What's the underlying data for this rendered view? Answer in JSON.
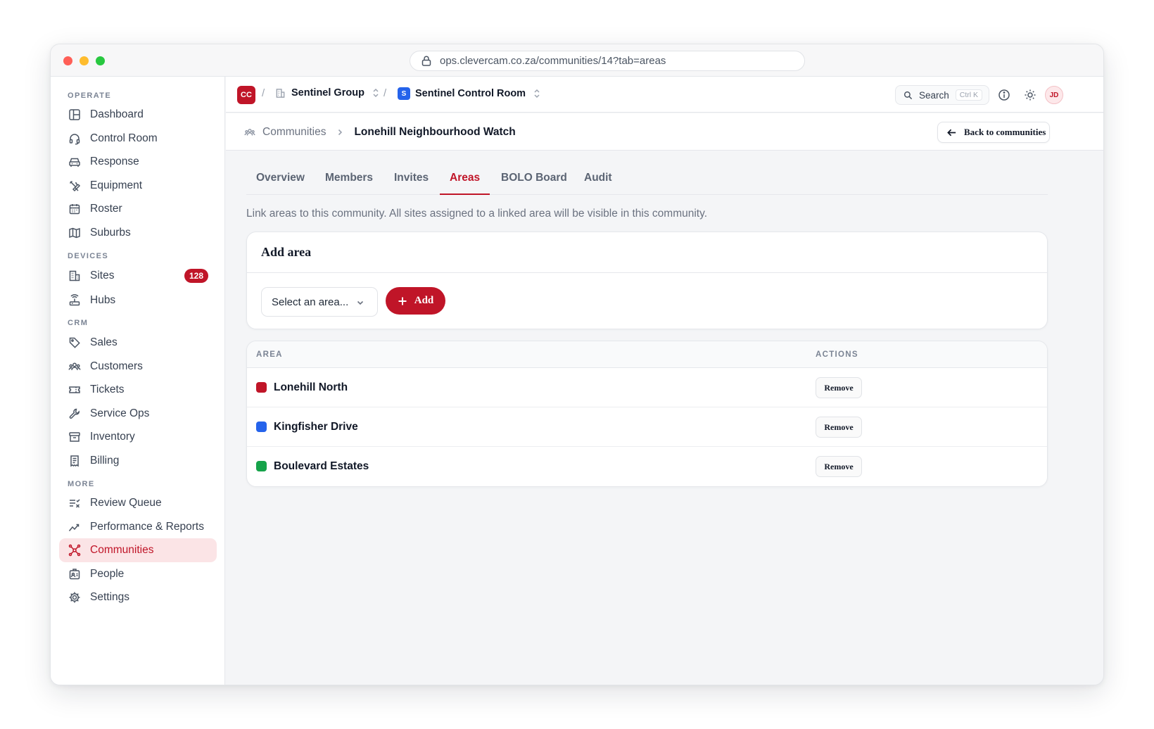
{
  "browser": {
    "url": "ops.clevercam.co.za/communities/14?tab=areas"
  },
  "sidebar": {
    "sections": [
      {
        "label": "OPERATE"
      },
      {
        "label": "DEVICES"
      },
      {
        "label": "CRM"
      },
      {
        "label": "MORE"
      }
    ],
    "items": [
      {
        "label": "Dashboard",
        "icon": "layout-icon"
      },
      {
        "label": "Control Room",
        "icon": "headset-icon"
      },
      {
        "label": "Response",
        "icon": "car-icon"
      },
      {
        "label": "Equipment",
        "icon": "tools-icon"
      },
      {
        "label": "Roster",
        "icon": "calendar-icon"
      },
      {
        "label": "Suburbs",
        "icon": "map-icon"
      },
      {
        "label": "Sites",
        "icon": "building-icon",
        "badge": "128"
      },
      {
        "label": "Hubs",
        "icon": "router-icon"
      },
      {
        "label": "Sales",
        "icon": "tag-icon"
      },
      {
        "label": "Customers",
        "icon": "users-icon"
      },
      {
        "label": "Tickets",
        "icon": "ticket-icon"
      },
      {
        "label": "Service Ops",
        "icon": "wrench-icon"
      },
      {
        "label": "Inventory",
        "icon": "archive-icon"
      },
      {
        "label": "Billing",
        "icon": "receipt-icon"
      },
      {
        "label": "Review Queue",
        "icon": "list-check-icon"
      },
      {
        "label": "Performance & Reports",
        "icon": "trend-icon"
      },
      {
        "label": "Communities",
        "icon": "network-icon",
        "active": true
      },
      {
        "label": "People",
        "icon": "id-badge-icon"
      },
      {
        "label": "Settings",
        "icon": "gear-icon"
      }
    ]
  },
  "topbar": {
    "org_logo": "CC",
    "org_name": "Sentinel Group",
    "room_logo": "S",
    "room_name": "Sentinel Control Room",
    "search_label": "Search",
    "search_shortcut": "Ctrl K",
    "avatar_initials": "JD"
  },
  "page": {
    "breadcrumb_parent": "Communities",
    "breadcrumb_current": "Lonehill Neighbourhood Watch",
    "back_label": "Back to communities",
    "tabs": [
      {
        "label": "Overview"
      },
      {
        "label": "Members"
      },
      {
        "label": "Invites"
      },
      {
        "label": "Areas",
        "active": true
      },
      {
        "label": "BOLO Board"
      },
      {
        "label": "Audit"
      }
    ],
    "intro": "Link areas to this community. All sites assigned to a linked area will be visible in this community."
  },
  "add_area": {
    "title": "Add area",
    "select_placeholder": "Select an area...",
    "add_label": "Add"
  },
  "areas_table": {
    "headers": {
      "area": "AREA",
      "actions": "ACTIONS"
    },
    "rows": [
      {
        "name": "Lonehill North",
        "color": "#c01528",
        "action": "Remove"
      },
      {
        "name": "Kingfisher Drive",
        "color": "#2563eb",
        "action": "Remove"
      },
      {
        "name": "Boulevard Estates",
        "color": "#16a34a",
        "action": "Remove"
      }
    ]
  }
}
